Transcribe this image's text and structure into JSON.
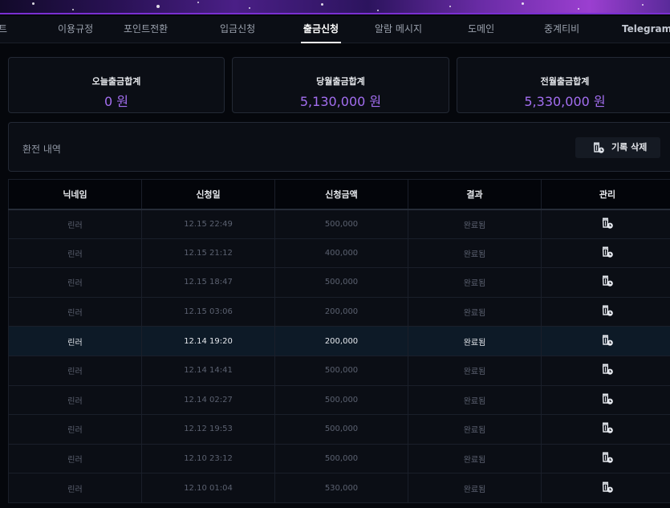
{
  "nav": {
    "items": [
      {
        "label": "트",
        "active": false
      },
      {
        "label": "이용규정",
        "active": false
      },
      {
        "label": "포인트전환",
        "active": false
      },
      {
        "label": "입금신청",
        "active": false
      },
      {
        "label": "출금신청",
        "active": true
      },
      {
        "label": "알람 메시지",
        "active": false
      },
      {
        "label": "도메인",
        "active": false
      },
      {
        "label": "중계티비",
        "active": false
      },
      {
        "label": "Telegram",
        "active": false
      }
    ]
  },
  "stats": [
    {
      "label": "오늘출금합계",
      "value": "0 원"
    },
    {
      "label": "당월출금합계",
      "value": "5,130,000 원"
    },
    {
      "label": "전월출금합계",
      "value": "5,330,000 원"
    }
  ],
  "history": {
    "title": "환전 내역",
    "delete_label": "기록 삭제"
  },
  "table": {
    "headers": [
      "닉네임",
      "신청일",
      "신청금액",
      "결과",
      "관리"
    ],
    "rows": [
      {
        "nick": "린러",
        "date": "12.15 22:49",
        "amount": "500,000",
        "result": "완료됨"
      },
      {
        "nick": "린러",
        "date": "12.15 21:12",
        "amount": "400,000",
        "result": "완료됨"
      },
      {
        "nick": "린러",
        "date": "12.15 18:47",
        "amount": "500,000",
        "result": "완료됨"
      },
      {
        "nick": "린러",
        "date": "12.15 03:06",
        "amount": "200,000",
        "result": "완료됨"
      },
      {
        "nick": "린러",
        "date": "12.14 19:20",
        "amount": "200,000",
        "result": "완료됨"
      },
      {
        "nick": "린러",
        "date": "12.14 14:41",
        "amount": "500,000",
        "result": "완료됨"
      },
      {
        "nick": "린러",
        "date": "12.14 02:27",
        "amount": "500,000",
        "result": "완료됨"
      },
      {
        "nick": "린러",
        "date": "12.12 19:53",
        "amount": "500,000",
        "result": "완료됨"
      },
      {
        "nick": "린러",
        "date": "12.10 23:12",
        "amount": "500,000",
        "result": "완료됨"
      },
      {
        "nick": "린러",
        "date": "12.10 01:04",
        "amount": "530,000",
        "result": "완료됨"
      }
    ]
  },
  "colors": {
    "accent": "#a36ef0",
    "banner": "#7a2fd1",
    "background": "#05070c",
    "panel": "#0b0e15",
    "highlight_row": "#0d1a27"
  }
}
